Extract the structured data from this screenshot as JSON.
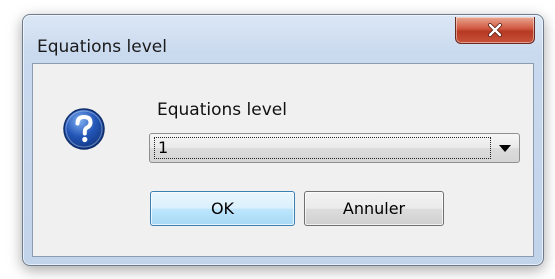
{
  "window": {
    "title": "Equations level",
    "close_icon": "close-icon"
  },
  "dialog": {
    "icon": "question-icon",
    "field_label": "Equations level",
    "combo": {
      "selected_value": "1"
    },
    "buttons": {
      "ok_label": "OK",
      "cancel_label": "Annuler"
    }
  },
  "colors": {
    "close_button": "#c8513a",
    "ok_border": "#3c7fb1",
    "question_icon": "#1d4fa8"
  }
}
